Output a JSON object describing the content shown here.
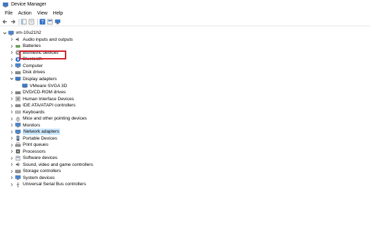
{
  "window": {
    "title": "Device Manager"
  },
  "menu": [
    "File",
    "Action",
    "View",
    "Help"
  ],
  "toolbar": [
    "back-icon",
    "forward-icon",
    "show-hide-console-tree-icon",
    "properties-icon",
    "help-icon",
    "update-driver-icon",
    "scan-hardware-icon"
  ],
  "tree": {
    "root": "vm-10u21h2",
    "categories": [
      {
        "label": "Audio inputs and outputs",
        "icon": "speaker-icon"
      },
      {
        "label": "Batteries",
        "icon": "battery-icon"
      },
      {
        "label": "Biometric devices",
        "icon": "fingerprint-icon"
      },
      {
        "label": "Bluetooth",
        "icon": "bluetooth-icon"
      },
      {
        "label": "Computer",
        "icon": "computer-icon"
      },
      {
        "label": "Disk drives",
        "icon": "disk-icon"
      },
      {
        "label": "Display adapters",
        "icon": "display-adapter-icon",
        "expanded": true,
        "children": [
          {
            "label": "VMware SVGA 3D",
            "icon": "display-adapter-icon"
          }
        ]
      },
      {
        "label": "DVD/CD-ROM drives",
        "icon": "dvd-icon"
      },
      {
        "label": "Human Interface Devices",
        "icon": "hid-icon"
      },
      {
        "label": "IDE ATA/ATAPI controllers",
        "icon": "ide-icon"
      },
      {
        "label": "Keyboards",
        "icon": "keyboard-icon"
      },
      {
        "label": "Mice and other pointing devices",
        "icon": "mouse-icon"
      },
      {
        "label": "Monitors",
        "icon": "monitor-icon"
      },
      {
        "label": "Network adapters",
        "icon": "network-icon",
        "selected": true
      },
      {
        "label": "Portable Devices",
        "icon": "portable-device-icon"
      },
      {
        "label": "Print queues",
        "icon": "printer-icon"
      },
      {
        "label": "Processors",
        "icon": "processor-icon"
      },
      {
        "label": "Software devices",
        "icon": "software-device-icon"
      },
      {
        "label": "Sound, video and game controllers",
        "icon": "sound-icon"
      },
      {
        "label": "Storage controllers",
        "icon": "storage-icon"
      },
      {
        "label": "System devices",
        "icon": "system-devices-icon"
      },
      {
        "label": "Universal Serial Bus controllers",
        "icon": "usb-icon"
      }
    ]
  },
  "colors": {
    "highlight": "#d0202a",
    "selected_bg": "#cce8ff",
    "folder": "#4a78b8"
  }
}
